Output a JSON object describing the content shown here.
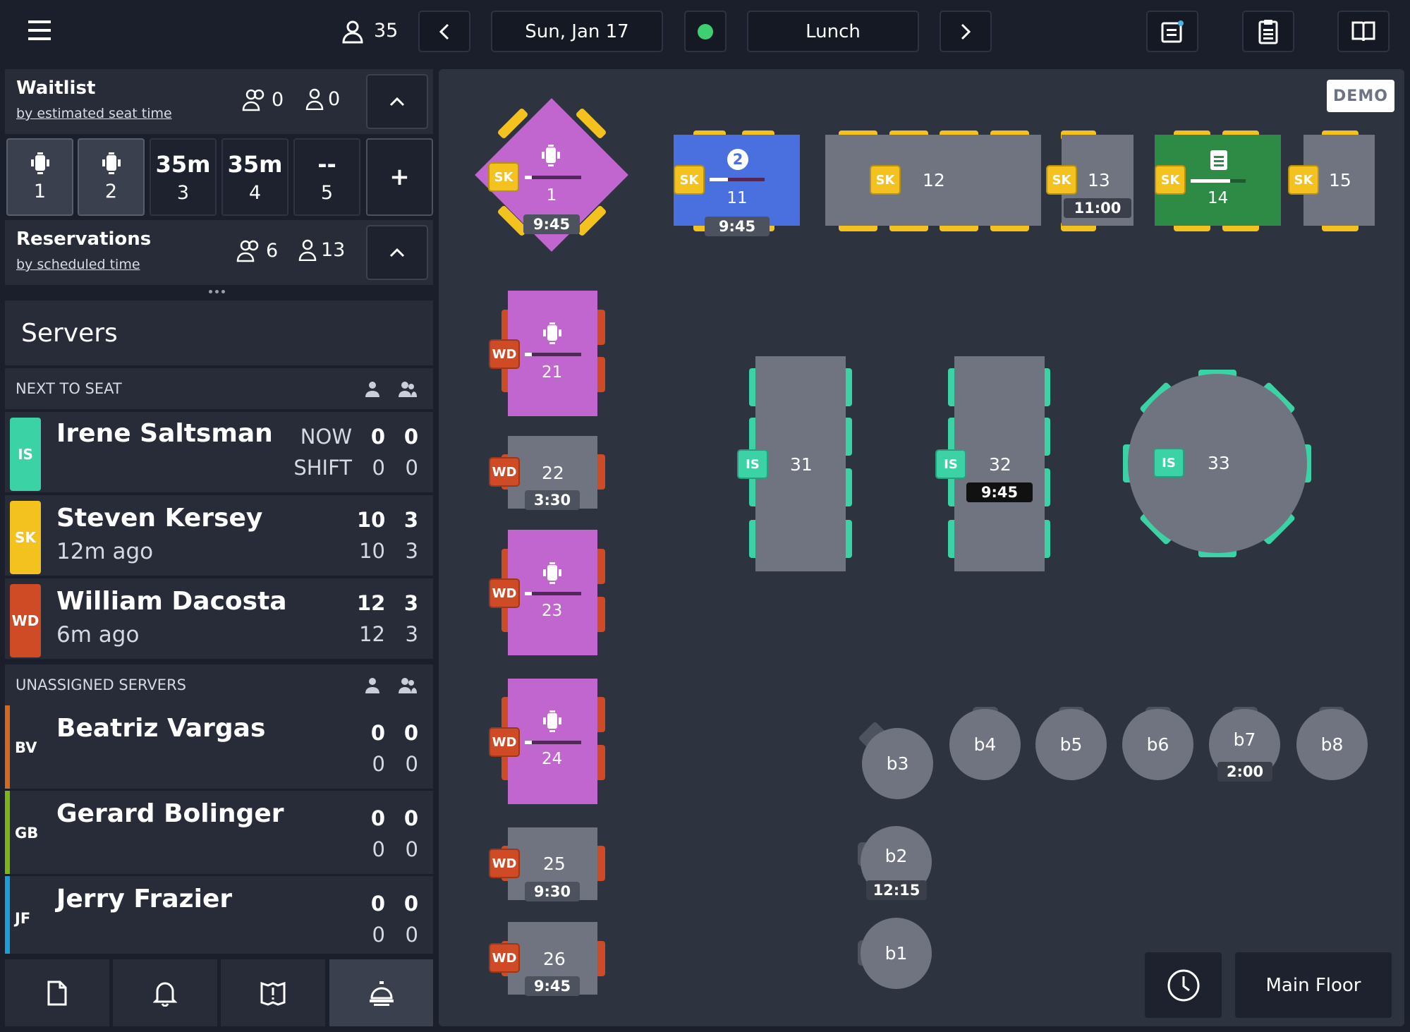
{
  "topbar": {
    "guest_count": "35",
    "date": "Sun, Jan 17",
    "shift": "Lunch"
  },
  "waitlist": {
    "title": "Waitlist",
    "sort": "by estimated seat time",
    "parties": "0",
    "covers": "0"
  },
  "slots": [
    {
      "top": "",
      "bottom": "1",
      "icon": true
    },
    {
      "top": "",
      "bottom": "2",
      "icon": true
    },
    {
      "top": "35m",
      "bottom": "3"
    },
    {
      "top": "35m",
      "bottom": "4"
    },
    {
      "top": "--",
      "bottom": "5"
    }
  ],
  "add_label": "+",
  "reservations": {
    "title": "Reservations",
    "sort": "by scheduled time",
    "parties": "6",
    "covers": "13"
  },
  "servers": {
    "title": "Servers",
    "next_header": "NEXT TO SEAT",
    "unassigned_header": "UNASSIGNED SERVERS",
    "now_label": "NOW",
    "shift_label": "SHIFT",
    "next": [
      {
        "initials": "IS",
        "name": "Irene Saltsman",
        "sub": "",
        "now_a": "0",
        "now_b": "0",
        "shift_a": "0",
        "shift_b": "0",
        "color": "#3bd2a6"
      },
      {
        "initials": "SK",
        "name": "Steven Kersey",
        "sub": "12m ago",
        "now_a": "10",
        "now_b": "3",
        "shift_a": "10",
        "shift_b": "3",
        "color": "#f4c21e"
      },
      {
        "initials": "WD",
        "name": "William Dacosta",
        "sub": "6m ago",
        "now_a": "12",
        "now_b": "3",
        "shift_a": "12",
        "shift_b": "3",
        "color": "#cf4b25"
      }
    ],
    "unassigned": [
      {
        "initials": "BV",
        "name": "Beatriz Vargas",
        "now_a": "0",
        "now_b": "0",
        "shift_a": "0",
        "shift_b": "0",
        "color": "#d2691e"
      },
      {
        "initials": "GB",
        "name": "Gerard Bolinger",
        "now_a": "0",
        "now_b": "0",
        "shift_a": "0",
        "shift_b": "0",
        "color": "#7cb518"
      },
      {
        "initials": "JF",
        "name": "Jerry Frazier",
        "now_a": "0",
        "now_b": "0",
        "shift_a": "0",
        "shift_b": "0",
        "color": "#1b9ed8"
      }
    ]
  },
  "floor": {
    "demo_label": "DEMO",
    "area_label": "Main Floor",
    "tables": {
      "t1": {
        "num": "1",
        "time": "9:45",
        "server": "SK"
      },
      "t11": {
        "num": "11",
        "time": "9:45",
        "server": "SK",
        "seat_count": "2"
      },
      "t12": {
        "num": "12",
        "server": "SK"
      },
      "t13": {
        "num": "13",
        "time": "11:00",
        "server": "SK"
      },
      "t14": {
        "num": "14",
        "server": "SK"
      },
      "t15": {
        "num": "15",
        "server": "SK"
      },
      "t21": {
        "num": "21",
        "server": "WD"
      },
      "t22": {
        "num": "22",
        "time": "3:30",
        "server": "WD"
      },
      "t23": {
        "num": "23",
        "server": "WD"
      },
      "t24": {
        "num": "24",
        "server": "WD"
      },
      "t25": {
        "num": "25",
        "time": "9:30",
        "server": "WD"
      },
      "t26": {
        "num": "26",
        "time": "9:45",
        "server": "WD"
      },
      "t31": {
        "num": "31",
        "server": "IS"
      },
      "t32": {
        "num": "32",
        "time": "9:45",
        "server": "IS"
      },
      "t33": {
        "num": "33",
        "server": "IS"
      },
      "b1": {
        "num": "b1"
      },
      "b2": {
        "num": "b2",
        "time": "12:15"
      },
      "b3": {
        "num": "b3"
      },
      "b4": {
        "num": "b4"
      },
      "b5": {
        "num": "b5"
      },
      "b6": {
        "num": "b6"
      },
      "b7": {
        "num": "b7",
        "time": "2:00"
      },
      "b8": {
        "num": "b8"
      }
    }
  }
}
